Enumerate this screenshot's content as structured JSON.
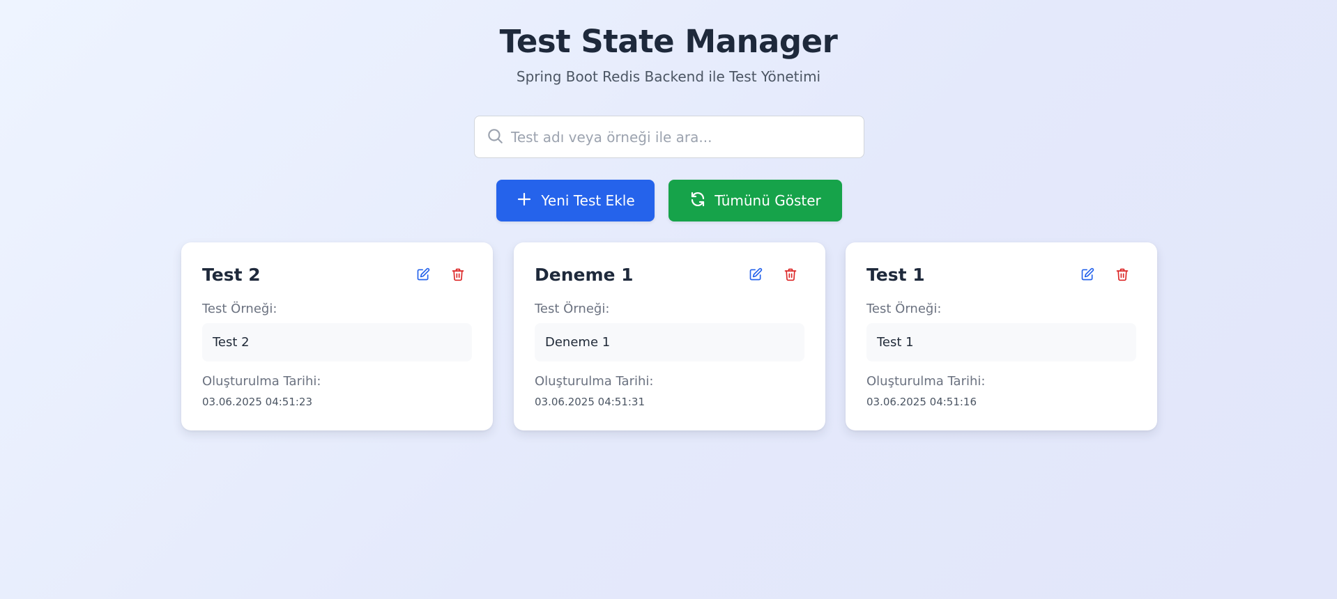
{
  "header": {
    "title": "Test State Manager",
    "subtitle": "Spring Boot Redis Backend ile Test Yönetimi"
  },
  "search": {
    "placeholder": "Test adı veya örneği ile ara...",
    "value": ""
  },
  "actions": {
    "add_label": "Yeni Test Ekle",
    "show_all_label": "Tümünü Göster"
  },
  "colors": {
    "primary": "#2563eb",
    "success": "#16a34a",
    "danger": "#dc2626"
  },
  "cards": [
    {
      "title": "Test 2",
      "example_label": "Test Örneği:",
      "example_value": "Test 2",
      "date_label": "Oluşturulma Tarihi:",
      "date_value": "03.06.2025 04:51:23"
    },
    {
      "title": "Deneme 1",
      "example_label": "Test Örneği:",
      "example_value": "Deneme 1",
      "date_label": "Oluşturulma Tarihi:",
      "date_value": "03.06.2025 04:51:31"
    },
    {
      "title": "Test 1",
      "example_label": "Test Örneği:",
      "example_value": "Test 1",
      "date_label": "Oluşturulma Tarihi:",
      "date_value": "03.06.2025 04:51:16"
    }
  ]
}
